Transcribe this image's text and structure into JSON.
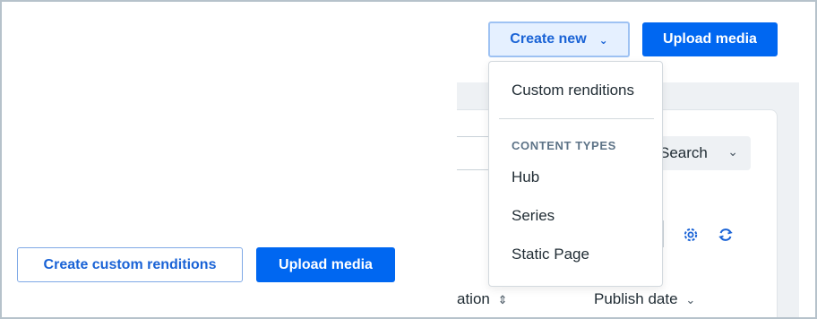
{
  "header": {
    "create_new_label": "Create new",
    "upload_media_label": "Upload media"
  },
  "dropdown": {
    "items": [
      {
        "label": "Custom renditions"
      }
    ],
    "section_heading": "CONTENT TYPES",
    "content_types": [
      {
        "label": "Hub"
      },
      {
        "label": "Series"
      },
      {
        "label": "Static Page"
      }
    ]
  },
  "background": {
    "search_label": "Search",
    "column_location": "ation",
    "column_publish_date": "Publish date"
  },
  "footer": {
    "create_custom_label": "Create custom renditions",
    "upload_media_label": "Upload media"
  },
  "colors": {
    "primary": "#0067f1",
    "primary_light": "#e5f0ff",
    "text": "#1f2b33",
    "muted_heading": "#5d7387"
  },
  "icons": {
    "create_new_caret": "chevron-down-icon",
    "search_caret": "chevron-down-icon",
    "settings": "gear-icon",
    "refresh": "refresh-icon",
    "sort": "sort-icon"
  }
}
